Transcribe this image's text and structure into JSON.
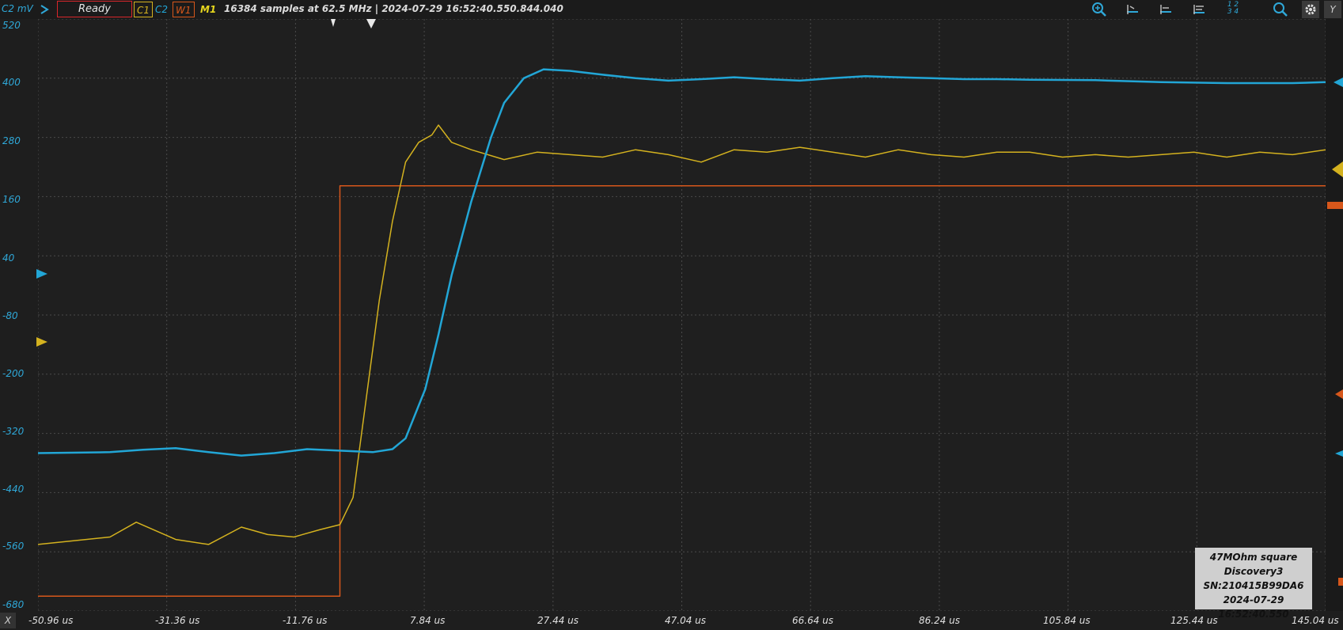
{
  "toolbar": {
    "channel_axis": "C2 mV",
    "status": "Ready",
    "channels": [
      "C1",
      "C2",
      "W1",
      "M1"
    ],
    "info": "16384 samples at 62.5 MHz  | 2024-07-29 16:52:40.550.844.040",
    "icons": [
      "zoom-in-icon",
      "cursor-h1-icon",
      "cursor-h2-icon",
      "cursor-h3-icon",
      "numbering-1234-icon",
      "zoom-icon",
      "gear-icon",
      "y-axis-icon"
    ],
    "y_button": "Y",
    "numbering_icon_text": "1 2\n3 4"
  },
  "colors": {
    "c1": "#d4b21f",
    "c2": "#22a6d6",
    "w1": "#d7571b",
    "m1": "#e6d61e",
    "grid": "#4a4a4a",
    "background": "#1f1f1f"
  },
  "x_axis_label": "X",
  "y_labels": [
    "520",
    "400",
    "280",
    "160",
    "40",
    "-80",
    "-200",
    "-320",
    "-440",
    "-560",
    "-680"
  ],
  "x_labels": [
    "-50.96 us",
    "-31.36 us",
    "-11.76 us",
    "7.84 us",
    "27.44 us",
    "47.04 us",
    "66.64 us",
    "86.24 us",
    "105.84 us",
    "125.44 us",
    "145.04 us"
  ],
  "note": {
    "line1": "47MOhm square",
    "line2": "Discovery3",
    "line3": "SN:210415B99DA6",
    "line4": "2024-07-29 16:52:40.550"
  },
  "chart_data": {
    "type": "line",
    "xlabel": "",
    "ylabel": "C2 mV",
    "xlim": [
      -50.96,
      145.04
    ],
    "ylim": [
      -680,
      520
    ],
    "grid": true,
    "series": [
      {
        "name": "W1",
        "x": [
          -50.96,
          -5.0,
          -5.0,
          145.04
        ],
        "y": [
          -650,
          -650,
          182,
          182
        ]
      },
      {
        "name": "C1",
        "x": [
          -50.96,
          -40,
          -36,
          -30,
          -25,
          -20,
          -16,
          -12,
          -8,
          -5,
          -3,
          -1,
          1,
          3,
          5,
          7,
          9,
          10,
          12,
          15,
          20,
          25,
          30,
          35,
          40,
          45,
          50,
          55,
          60,
          65,
          70,
          75,
          80,
          85,
          90,
          95,
          100,
          105,
          110,
          115,
          120,
          125,
          130,
          135,
          140,
          145.04
        ],
        "y": [
          -545,
          -530,
          -500,
          -535,
          -545,
          -510,
          -525,
          -530,
          -515,
          -505,
          -450,
          -250,
          -50,
          110,
          230,
          270,
          285,
          305,
          270,
          255,
          235,
          250,
          245,
          240,
          255,
          245,
          230,
          255,
          250,
          260,
          250,
          240,
          255,
          245,
          240,
          250,
          250,
          240,
          245,
          240,
          245,
          250,
          240,
          250,
          245,
          255
        ]
      },
      {
        "name": "C2",
        "x": [
          -50.96,
          -40,
          -35,
          -30,
          -25,
          -20,
          -15,
          -10,
          -5,
          0,
          3,
          5,
          8,
          10,
          12,
          15,
          18,
          20,
          23,
          26,
          30,
          35,
          40,
          45,
          50,
          55,
          60,
          65,
          70,
          75,
          80,
          85,
          90,
          95,
          100,
          110,
          120,
          130,
          140,
          145.04
        ],
        "y": [
          -360,
          -358,
          -353,
          -350,
          -358,
          -365,
          -360,
          -352,
          -355,
          -358,
          -352,
          -330,
          -230,
          -120,
          0,
          150,
          280,
          350,
          400,
          418,
          415,
          407,
          400,
          395,
          398,
          402,
          398,
          395,
          400,
          404,
          402,
          400,
          398,
          398,
          397,
          396,
          392,
          390,
          390,
          392
        ]
      }
    ]
  }
}
